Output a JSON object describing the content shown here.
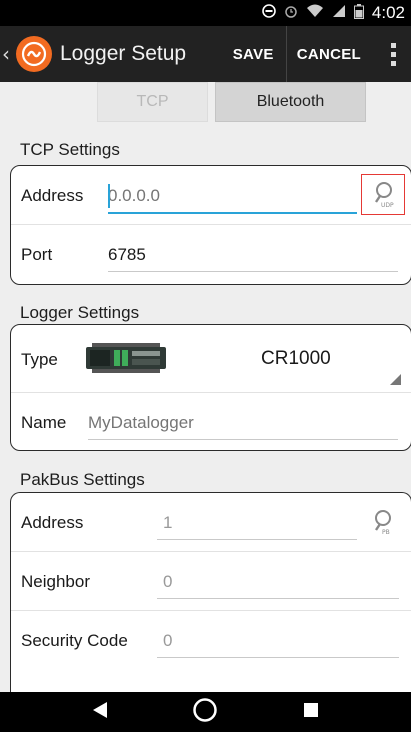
{
  "status_bar": {
    "time": "4:02"
  },
  "app_bar": {
    "title": "Logger Setup",
    "save_label": "SAVE",
    "cancel_label": "CANCEL"
  },
  "connection_tabs": {
    "tcp_label": "TCP",
    "bluetooth_label": "Bluetooth",
    "selected": "Bluetooth"
  },
  "tcp_settings": {
    "header": "TCP Settings",
    "address_label": "Address",
    "address_placeholder": "0.0.0.0",
    "udp_search_label": "UDP",
    "port_label": "Port",
    "port_value": "6785"
  },
  "logger_settings": {
    "header": "Logger Settings",
    "type_label": "Type",
    "type_value": "CR1000",
    "name_label": "Name",
    "name_placeholder": "MyDatalogger"
  },
  "pakbus_settings": {
    "header": "PakBus Settings",
    "address_label": "Address",
    "address_value": "1",
    "pb_search_label": "PB",
    "neighbor_label": "Neighbor",
    "neighbor_value": "0",
    "security_label": "Security Code",
    "security_value": "0"
  },
  "colors": {
    "accent": "#29a3d8",
    "brand": "#f26b21",
    "highlight": "#e53935"
  }
}
